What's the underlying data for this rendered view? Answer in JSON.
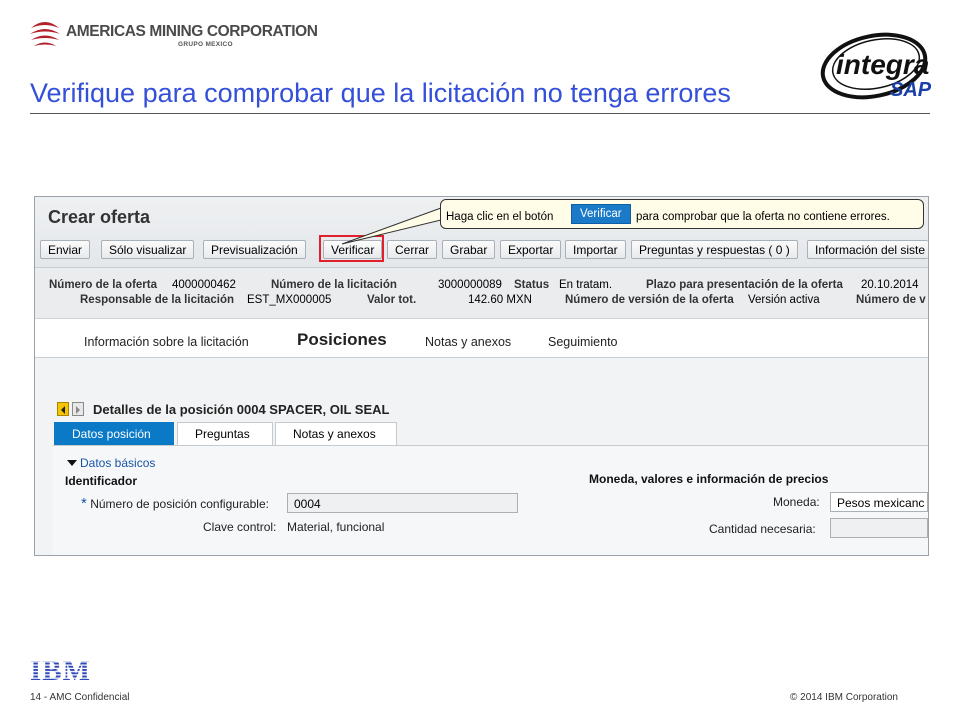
{
  "slide": {
    "company_name": "AMERICAS MINING CORPORATION",
    "company_group": "GRUPO MEXICO",
    "title": "Verifique para comprobar que la licitación no tenga errores",
    "integra_logo_text_1": "integra",
    "integra_logo_text_2": "SAP",
    "footer_left": "14 - AMC Confidencial",
    "footer_right": "© 2014 IBM Corporation",
    "ibm_logo_text": "IBM"
  },
  "colors": {
    "title": "#3550d8",
    "highlight": "#e0202a",
    "active_tab": "#0a79c6",
    "callout_bg": "#fffce8"
  },
  "callout": {
    "text_before": "Haga clic en el botón",
    "button_label": "Verificar",
    "text_after": "para comprobar que la oferta no contiene errores."
  },
  "sap": {
    "heading": "Crear oferta",
    "toolbar": [
      "Enviar",
      "Sólo visualizar",
      "Previsualización",
      "Verificar",
      "Cerrar",
      "Grabar",
      "Exportar",
      "Importar",
      "Preguntas y respuestas ( 0 )",
      "Información del siste"
    ],
    "info": {
      "numero_oferta_label": "Número de la oferta",
      "numero_oferta_value": "4000000462",
      "numero_licitacion_label": "Número de la licitación",
      "numero_licitacion_value": "3000000089",
      "status_label": "Status",
      "status_value": "En tratam.",
      "plazo_label": "Plazo para presentación de la oferta",
      "plazo_value": "20.10.2014",
      "responsable_label": "Responsable de la licitación",
      "responsable_value": "EST_MX000005",
      "valor_label": "Valor tot.",
      "valor_value": "142.60 MXN",
      "version_label": "Número de versión de la oferta",
      "version_value": "Versión activa",
      "numero_v_label": "Número de v"
    },
    "tabs": [
      "Información sobre la licitación",
      "Posiciones",
      "Notas y anexos",
      "Seguimiento"
    ],
    "detail_title": "Detalles de la posición 0004 SPACER, OIL SEAL",
    "sub_tabs": [
      "Datos posición",
      "Preguntas",
      "Notas y anexos"
    ],
    "section_label": "Datos básicos",
    "identificador_heading": "Identificador",
    "moneda_heading": "Moneda, valores e información de precios",
    "fields": {
      "posicion_label": "Número de posición configurable:",
      "posicion_value": "0004",
      "clave_label": "Clave control:",
      "clave_value": "Material, funcional",
      "moneda_label": "Moneda:",
      "moneda_value": "Pesos mexicanc",
      "cantidad_label": "Cantidad necesaria:",
      "cantidad_value": ""
    }
  }
}
